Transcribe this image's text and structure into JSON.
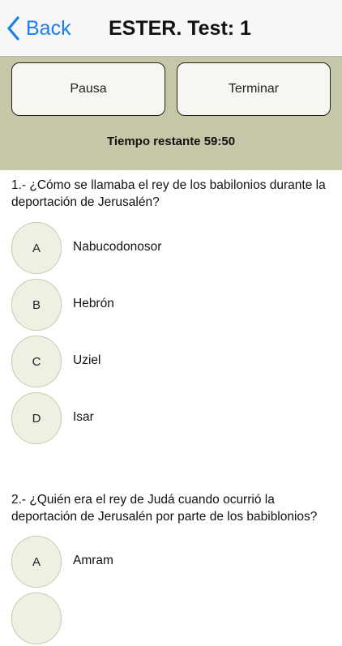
{
  "nav": {
    "back_label": "Back",
    "title": "ESTER. Test: 1",
    "accent_color": "#1a7ef0"
  },
  "controls": {
    "pause_label": "Pausa",
    "finish_label": "Terminar",
    "timer_text": "Tiempo restante 59:50",
    "panel_color": "#c6c6a8"
  },
  "questions": [
    {
      "text": "1.- ¿Cómo se llamaba el rey de los babilonios durante la deportación de Jerusalén?",
      "options": [
        {
          "letter": "A",
          "text": "Nabucodonosor"
        },
        {
          "letter": "B",
          "text": "Hebrón"
        },
        {
          "letter": "C",
          "text": "Uziel"
        },
        {
          "letter": "D",
          "text": "Isar"
        }
      ]
    },
    {
      "text": "2.- ¿Quién era el rey de Judá cuando ocurrió la deportación de Jerusalén por parte de los babiblonios?",
      "options": [
        {
          "letter": "A",
          "text": "Amram"
        },
        {
          "letter": "",
          "text": ""
        }
      ]
    }
  ]
}
